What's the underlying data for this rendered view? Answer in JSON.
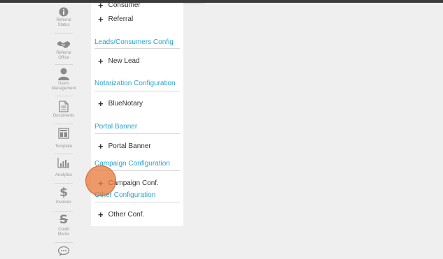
{
  "colors": {
    "accent": "#29a3cf",
    "text": "#333333",
    "rail_icon": "#8a8a8a",
    "click_marker": "#e87c40"
  },
  "rail": {
    "items": [
      {
        "icon": "info-icon",
        "label": "Referral\nStatus"
      },
      {
        "icon": "handshake-icon",
        "label": "Referral\nOffice"
      },
      {
        "icon": "user-icon",
        "label": "Users\nManagement"
      },
      {
        "icon": "document-icon",
        "label": "Documents"
      },
      {
        "icon": "template-icon",
        "label": "Template"
      },
      {
        "icon": "analytics-icon",
        "label": "Analytics"
      },
      {
        "icon": "dollar-icon",
        "label": "Invoices"
      },
      {
        "icon": "credit-memo-icon",
        "label": "Credit\nMemo"
      },
      {
        "icon": "chat-icon",
        "label": ""
      }
    ]
  },
  "panel": {
    "top_items": [
      "Consumer",
      "Referral"
    ],
    "sections": [
      {
        "title": "Leads/Consumers Config",
        "items": [
          "New Lead"
        ]
      },
      {
        "title": "Notarization Configuration",
        "items": [
          "BlueNotary"
        ]
      },
      {
        "title": "Portal Banner",
        "items": [
          "Portal Banner"
        ]
      },
      {
        "title": "Campaign Configuration",
        "items": [
          "Campaign Conf."
        ]
      },
      {
        "title": "Other Configuration",
        "items": [
          "Other Conf."
        ]
      }
    ]
  }
}
